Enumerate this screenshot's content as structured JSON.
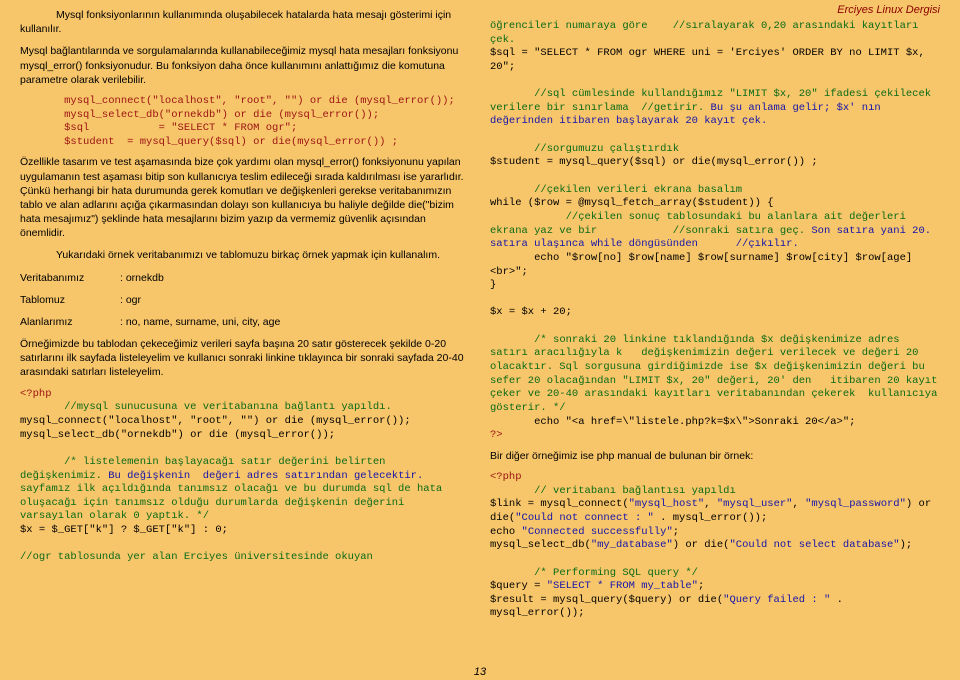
{
  "header": {
    "title": "Erciyes Linux Dergisi"
  },
  "page_number": "13",
  "left": {
    "p1": "Mysql fonksiyonlarının kullanımında oluşabilecek hatalarda hata mesajı gösterimi için kullanılır.",
    "p2": "Mysql bağlantılarında ve sorgulamalarında kullanabileceğimiz mysql hata mesajları fonksiyonu mysql_error() fonksiyonudur. Bu fonksiyon daha önce kullanımını anlattığımız die komutuna parametre olarak verilebilir.",
    "code1_l1": "       mysql_connect(\"localhost\", \"root\", \"\") or die (mysql_error());",
    "code1_l2": "       mysql_select_db(\"ornekdb\") or die (mysql_error());",
    "code1_l3": "       $sql           = \"SELECT * FROM ogr\";",
    "code1_l4": "       $student  = mysql_query($sql) or die(mysql_error()) ;",
    "p3": "Özellikle tasarım ve test aşamasında bize çok yardımı olan mysql_error() fonksiyonunu yapılan uygulamanın test aşaması bitip son kullanıcıya teslim edileceği sırada kaldırılması ise yararlıdır. Çünkü herhangi bir hata durumunda gerek komutları ve değişkenleri gerekse veritabanımızın tablo ve alan adlarını açığa çıkarmasından dolayı son kullanıcıya bu haliyle değilde die(\"bizim hata mesajımız\") şeklinde hata mesajlarını bizim yazıp da vermemiz güvenlik açısından önemlidir.",
    "p4": "Yukarıdaki örnek veritabanımızı ve tablomuzu birkaç örnek yapmak için kullanalım.",
    "p5a": "Veritabanımız",
    "p5b": ": ornekdb",
    "p6a": "Tablomuz",
    "p6b": ": ogr",
    "p7a": "Alanlarımız",
    "p7b": ": no, name, surname, uni, city, age",
    "p8": "Örneğimizde bu tablodan çekeceğimiz verileri sayfa başına 20 satır gösterecek şekilde 0-20 satırlarını ilk sayfada listeleyelim ve kullanıcı sonraki linkine tıklayınca bir sonraki sayfada 20-40 arasındaki satırları listeleyelim.",
    "c2_php": "<?php",
    "c2_c1": "       //mysql sunucusuna ve veritabanına bağlantı yapıldı.",
    "c2_l1": "mysql_connect(\"localhost\", \"root\", \"\") or die (mysql_error());",
    "c2_l2": "mysql_select_db(\"ornekdb\") or die (mysql_error());",
    "c2_c2a": "       /* listelemenin başlayacağı satır değerini belirten değişkenimiz. ",
    "c2_c2b": "Bu değişkenin  değeri adres satırından gelecektir. ",
    "c2_c2c": "sayfamız ilk açıldığında tanımsız olacağı ve bu durumda sql de hata oluşacağı için tanımsız olduğu durumlarda değişkenin değerini   varsayılan olarak 0 yaptık. */",
    "c2_l3": "$x = $_GET[\"k\"] ? $_GET[\"k\"] : 0;",
    "c2_c3a": "//ogr tablosunda yer alan Erciyes üniversitesinde okuyan "
  },
  "right": {
    "c2_c3b": "öğrencileri numaraya göre    //sıralayarak 0,20 arasındaki kayıtları çek.",
    "r_l1": "$sql = \"SELECT * FROM ogr WHERE uni = 'Erciyes' ORDER BY no LIMIT $x, 20\";",
    "r_c1a": "       //sql cümlesinde kullandığımız \"LIMIT $x, 20\" ifadesi çekilecek verilere bir sınırlama  //getirir. ",
    "r_c1b": "Bu şu anlama gelir; $x' nın değerinden itibaren başlayarak 20 kayıt çek.",
    "r_c2": "       //sorgumuzu çalıştırdık",
    "r_l2": "$student = mysql_query($sql) or die(mysql_error()) ;",
    "r_c3": "       //çekilen verileri ekrana basalım",
    "r_l3": "while ($row = @mysql_fetch_array($student)) {",
    "r_c4a": "            //çekilen sonuç tablosundaki bu alanlara ait değerleri ekrana yaz ve bir            //sonraki satıra geç. ",
    "r_c4b": "Son satıra yani 20.  satıra ulaşınca while döngüsünden      //çıkılır.",
    "r_l4": "       echo \"$row[no] $row[name] $row[surname] $row[city] $row[age] <br>\";",
    "r_l5": "}",
    "r_l6": "$x = $x + 20;",
    "r_c5": "       /* sonraki 20 linkine tıklandığında $x değişkenimize adres satırı aracılığıyla k   değişkenimizin değeri verilecek ve değeri 20 olacaktır. Sql sorgusuna girdiğimizde ise $x değişkenimizin değeri bu sefer 20 olacağından \"LIMIT $x, 20\" değeri, 20' den   itibaren 20 kayıt çeker ve 20-40 arasındaki kayıtları veritabanından çekerek  kullanıcıya gösterir. */",
    "r_l7": "       echo \"<a href=\\\"listele.php?k=$x\\\">Sonraki 20</a>\";",
    "r_l8": "?>",
    "p9": "Bir diğer örneğimiz ise php manual de bulunan bir örnek:",
    "e_php": "<?php",
    "e_c1": "       // veritabanı bağlantısı yapıldı",
    "e_l1a": "$link = mysql_connect(",
    "e_l1b": "\"mysql_host\"",
    "e_l1c": ", ",
    "e_l1d": "\"mysql_user\"",
    "e_l1e": ", ",
    "e_l1f": "\"mysql_password\"",
    "e_l1g": ") or die(",
    "e_l1h": "\"Could not connect : \" ",
    "e_l1i": ". mysql_error());",
    "e_l2a": "echo ",
    "e_l2b": "\"Connected successfully\"",
    "e_l2c": ";",
    "e_l3a": "mysql_select_db(",
    "e_l3b": "\"my_database\"",
    "e_l3c": ") or die(",
    "e_l3d": "\"Could not select database\"",
    "e_l3e": ");",
    "e_c2": "       /* Performing SQL query */",
    "e_l4a": "$query = ",
    "e_l4b": "\"SELECT * FROM my_table\"",
    "e_l4c": ";",
    "e_l5a": "$result = mysql_query($query) or die(",
    "e_l5b": "\"Query failed : \" ",
    "e_l5c": ". mysql_error());"
  }
}
